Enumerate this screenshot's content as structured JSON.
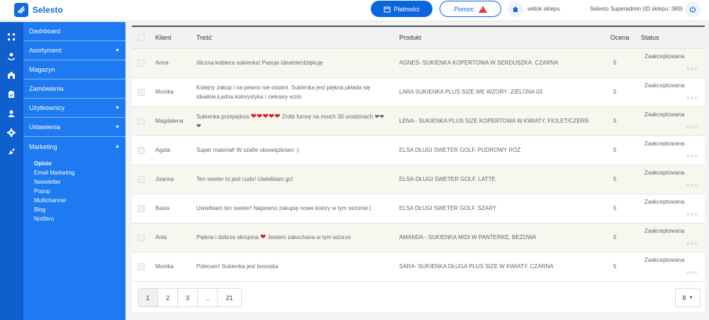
{
  "app": {
    "name": "Selesto"
  },
  "topbar": {
    "payments_label": "Płatności",
    "help_label": "Pomoc",
    "shop_view_label": "widok sklepu",
    "user_label": "Selesto Superadmin (ID sklepu: 389)"
  },
  "sidebar": {
    "items": [
      {
        "label": "Dashboard"
      },
      {
        "label": "Asortyment"
      },
      {
        "label": "Magazyn"
      },
      {
        "label": "Zamówienia"
      },
      {
        "label": "Użytkownicy"
      },
      {
        "label": "Ustawienia"
      },
      {
        "label": "Marketing"
      }
    ],
    "submenu": [
      {
        "label": "Opinie"
      },
      {
        "label": "Email Marketing"
      },
      {
        "label": "Newsletter"
      },
      {
        "label": "Popup"
      },
      {
        "label": "Multichannel"
      },
      {
        "label": "Blog"
      },
      {
        "label": "Notifero"
      }
    ]
  },
  "table": {
    "headers": {
      "client": "Klient",
      "content": "Treść",
      "product": "Produkt",
      "rating": "Ocena",
      "status": "Status"
    },
    "rows": [
      {
        "client": "Anna",
        "content": "śliczna kobieca sukienka! Pasuje idealnie!dziękuję",
        "hearts": "",
        "content_tail": "",
        "product": "AGNES- SUKIENKA KOPERTOWA W SERDUSZKA. CZARNA",
        "rating": "5",
        "status": "Zaakceptowana"
      },
      {
        "client": "Monika",
        "content": "Kolejny zakup i na pewno nie ostatni. Sukienka jest piękna,układa się idealnie.Ładna kolorystyka i ciekawy wzór.",
        "hearts": "",
        "content_tail": "",
        "product": "LARA SUKIENKA PLUS SIZE WE WZORY .ZIELONA 03",
        "rating": "5",
        "status": "Zaakceptowana"
      },
      {
        "client": "Magdalena",
        "content": "Sukienka przepiękna",
        "hearts": "❤❤❤❤❤",
        "content_tail": "Zrobi furorę na moich 30 urodzinach ❤❤❤",
        "product": "LENA - SUKIENKA PLUS SIZE KOPERTOWA W KWIATY. FIOLET/CZERŃ",
        "rating": "5",
        "status": "Zaakceptowana"
      },
      {
        "client": "Agata",
        "content": "Super materiał! W szafie obowiązkowo :)",
        "hearts": "",
        "content_tail": "",
        "product": "ELSA DŁUGI SWETER GOLF. PUDROWY RÓŻ",
        "rating": "5",
        "status": "Zaakceptowana"
      },
      {
        "client": "Joanna",
        "content": "Ten sweter to jest cudo! Uwielbiam go!",
        "hearts": "",
        "content_tail": "",
        "product": "ELSA-DŁUGI SWETER GOLF. LATTE",
        "rating": "5",
        "status": "Zaakceptowana"
      },
      {
        "client": "Basia",
        "content": "Uwielbiam ten sweter! Napewno zakupię nowe kolory w tym sezonie:)",
        "hearts": "",
        "content_tail": "",
        "product": "ELSA DŁUGI SWETER GOLF. SZARY",
        "rating": "5",
        "status": "Zaakceptowana"
      },
      {
        "client": "Ania",
        "content": "Piękna i dobrze skrojona",
        "hearts": "❤",
        "content_tail": "Jestem zakochana w tym wzorze",
        "product": "AMANDA - SUKIENKA MIDI W PANTERKĘ. BEŻOWA",
        "rating": "5",
        "status": "Zaakceptowana"
      },
      {
        "client": "Monika",
        "content": "Polecam! Sukienka jest boooska",
        "hearts": "",
        "content_tail": "",
        "product": "SARA- SUKIENKA DŁUGA PLUS SIZE W KWIATY. CZARNA",
        "rating": "5",
        "status": "Zaakceptowana"
      }
    ]
  },
  "pagination": {
    "pages": [
      "1",
      "2",
      "3",
      "..",
      "21"
    ],
    "current": "1"
  },
  "per_page": {
    "value": "8"
  },
  "colors": {
    "primary": "#0a66dc",
    "sidebar": "#1d7af0",
    "sidebar_dark": "#0f5fcf",
    "heart": "#d4202a",
    "warning": "#e0373a"
  }
}
